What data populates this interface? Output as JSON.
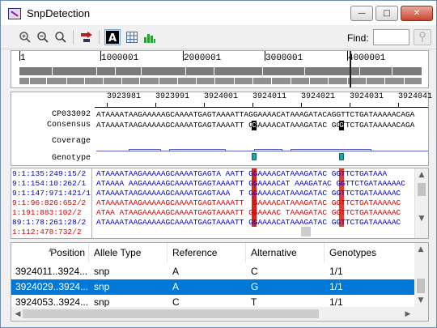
{
  "window": {
    "title": "SnpDetection",
    "minimize_glyph": "—",
    "maximize_glyph": "□",
    "close_glyph": "✕"
  },
  "toolbar": {
    "find_label": "Find:",
    "find_value": "",
    "buttons": [
      "zoom-in-icon",
      "zoom-out-icon",
      "zoom-fit-icon",
      "jump-to-icon",
      "font-toggle-icon",
      "grid-icon",
      "chart-icon"
    ]
  },
  "overview": {
    "labels": [
      "1",
      "1000001",
      "2000001",
      "3000001",
      "4000001"
    ]
  },
  "ruler": {
    "labels": [
      "3923981",
      "3923991",
      "3924001",
      "3924011",
      "3924021",
      "3924031",
      "3924041"
    ]
  },
  "tracks": {
    "reference_label": "CP033092",
    "consensus_label": "Consensus",
    "coverage_label": "Coverage",
    "genotype_label": "Genotype",
    "reference_seq": "ATAAAATAAGAAAAAGCAAAATGAGTAAAATTAGGAAAACATAAAGATACAGGTTCTGATAAAAACAGA",
    "consensus_seq": "ATAAAATAAGAAAAAGCAAAATGAGTAAAATT GGAAAACATAAAGATAC GGTTCTGATAAAAACAGA",
    "consensus_variant_1": "C",
    "consensus_variant_2": "G"
  },
  "reads": {
    "names": [
      "9:1:135:249:15/2",
      "9:1:154:10:262/1",
      "9:1:147:971:421/1",
      "9:1:96:826:652/2",
      "1:191:883:102/2",
      "89:1:78:261:28/2",
      "1:112:478:732/2"
    ],
    "sequences": [
      "ATAAAATAAGAAAAAGCAAAATGAGTA AATT GGAAAACATAAAGATAC GGTTCTGATAAA",
      "ATAAAA AAGAAAAAGCAAAATGAGTAAAATT GGAAAACAT AAAGATAC GGTTCTGATAAAAAC",
      "ATAAAATAAGAAAAAGCAAAATGAGTAAA  T GGAAAACATAAAGATAC GGTTCTGATAAAAAC",
      "ATAAAATAAGAAAAAGCAAAATGAGTAAAATT  GAAAACATAAAGATAC GGTTCTGATAAAAAC",
      "ATAA ATAAGAAAAAGCAAAATGAGTAAAATT GGAAAAC TAAAGATAC GGTTCTGATAAAAAC",
      "ATAAAATAAGAAAAAGCAAAATGAGTAAAATT GGAAAACATAAAGATAC GGTTCTGATAAAAAC",
      "ATAAAATAAGAAAAAGCAAAATGAGTAAAATT GGAAAACATAAAGATAC GGTTCTGATAAAAAC"
    ],
    "colors": [
      "#0000c0",
      "#0000c0",
      "#0000c0",
      "#d00000",
      "#d00000",
      "#0000c0",
      "#d00000"
    ]
  },
  "table": {
    "headers": [
      "Position",
      "Allele Type",
      "Reference",
      "Alternative",
      "Genotypes"
    ],
    "rows": [
      [
        "3924011..3924...",
        "snp",
        "A",
        "C",
        "1/1"
      ],
      [
        "3924029..3924...",
        "snp",
        "A",
        "G",
        "1/1"
      ],
      [
        "3924053..3924...",
        "snp",
        "C",
        "T",
        "1/1"
      ]
    ],
    "selected_row": 1
  },
  "colors": {
    "selection": "#0078d7",
    "mismatch": "#d9211f",
    "genotype": "#1aa7a7",
    "coverage": "#5a5fbf"
  }
}
